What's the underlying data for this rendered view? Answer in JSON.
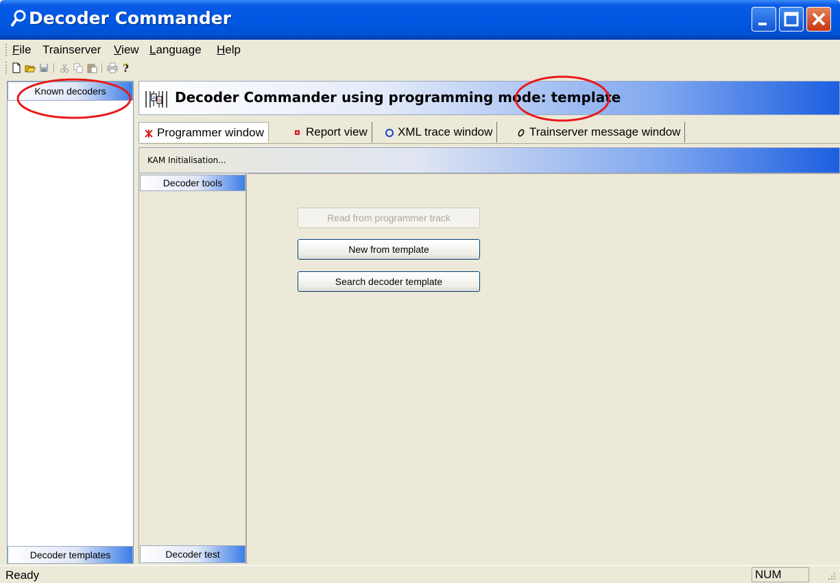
{
  "window": {
    "title": "Decoder Commander",
    "colors": {
      "titlebar": "#0058e3",
      "close": "#c63610",
      "accent": "#1c5fe0",
      "annotation": "#e8191b"
    }
  },
  "menubar": {
    "items": [
      {
        "label": "File",
        "mnemonic": "F",
        "rest": "ile"
      },
      {
        "label": "Trainserver",
        "mnemonic": "",
        "rest": "Trainserver"
      },
      {
        "label": "View",
        "mnemonic": "V",
        "rest": "iew"
      },
      {
        "label": "Language",
        "mnemonic": "L",
        "rest": "anguage"
      },
      {
        "label": "Help",
        "mnemonic": "H",
        "rest": "elp"
      }
    ]
  },
  "toolbar": {
    "icons": [
      "new-icon",
      "open-icon",
      "save-icon",
      "cut-icon",
      "copy-icon",
      "paste-icon",
      "print-icon",
      "help-icon"
    ]
  },
  "left_pane": {
    "top_tab": "Known decoders",
    "bottom_tab": "Decoder templates"
  },
  "header": {
    "title": "Decoder Commander using programming mode: template"
  },
  "tabs": [
    {
      "label": "Programmer window",
      "icon": "programmer-icon",
      "active": true
    },
    {
      "label": "Report view",
      "icon": "report-icon",
      "active": false
    },
    {
      "label": "XML trace window",
      "icon": "xml-icon",
      "active": false
    },
    {
      "label": "Trainserver message window",
      "icon": "message-icon",
      "active": false
    }
  ],
  "kam_bar": {
    "label": "KAM Initialisation..."
  },
  "tools_pane": {
    "top_tab": "Decoder tools",
    "bottom_tab": "Decoder test"
  },
  "content": {
    "buttons": [
      {
        "label": "Read from programmer track",
        "enabled": false
      },
      {
        "label": "New from template",
        "enabled": true
      },
      {
        "label": "Search decoder template",
        "enabled": true
      }
    ]
  },
  "statusbar": {
    "status": "Ready",
    "num": "NUM"
  }
}
